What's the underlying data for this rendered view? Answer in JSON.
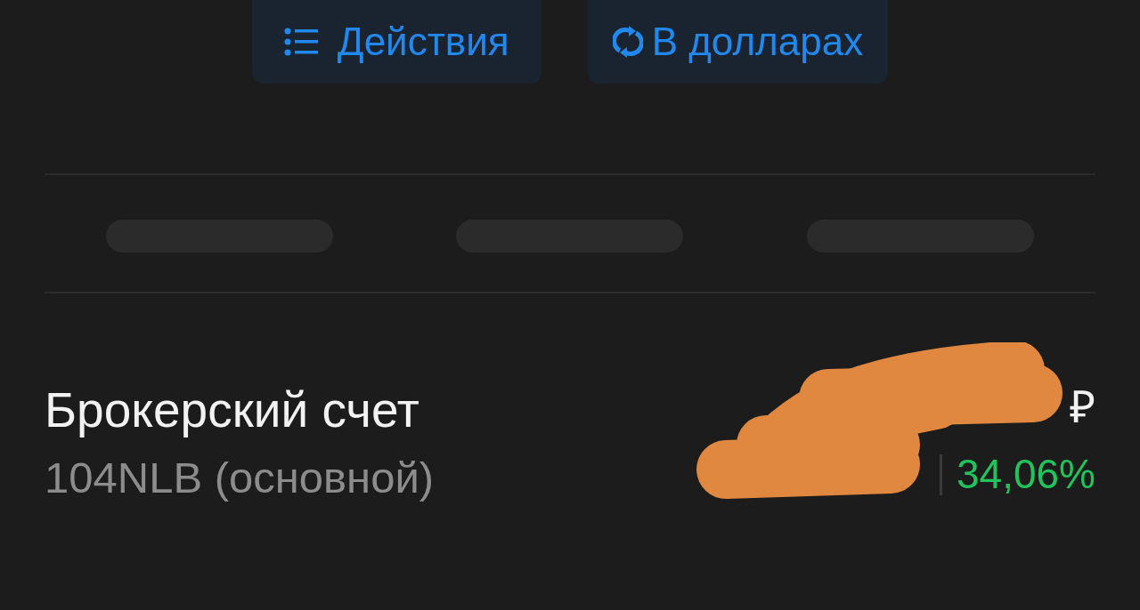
{
  "actions": [
    {
      "label": "Действия",
      "kind": "menu"
    },
    {
      "label": "В долларах",
      "kind": "convert"
    }
  ],
  "summary": [
    {
      "kind": "placeholder"
    },
    {
      "kind": "placeholder"
    },
    {
      "kind": "placeholder"
    }
  ],
  "account": {
    "title": "Брокерский счет",
    "subtitle": "104NLB (основной)",
    "currency": "₽",
    "change": {
      "percent": "34,06%",
      "kind": "gain"
    },
    "redacted": true
  }
}
